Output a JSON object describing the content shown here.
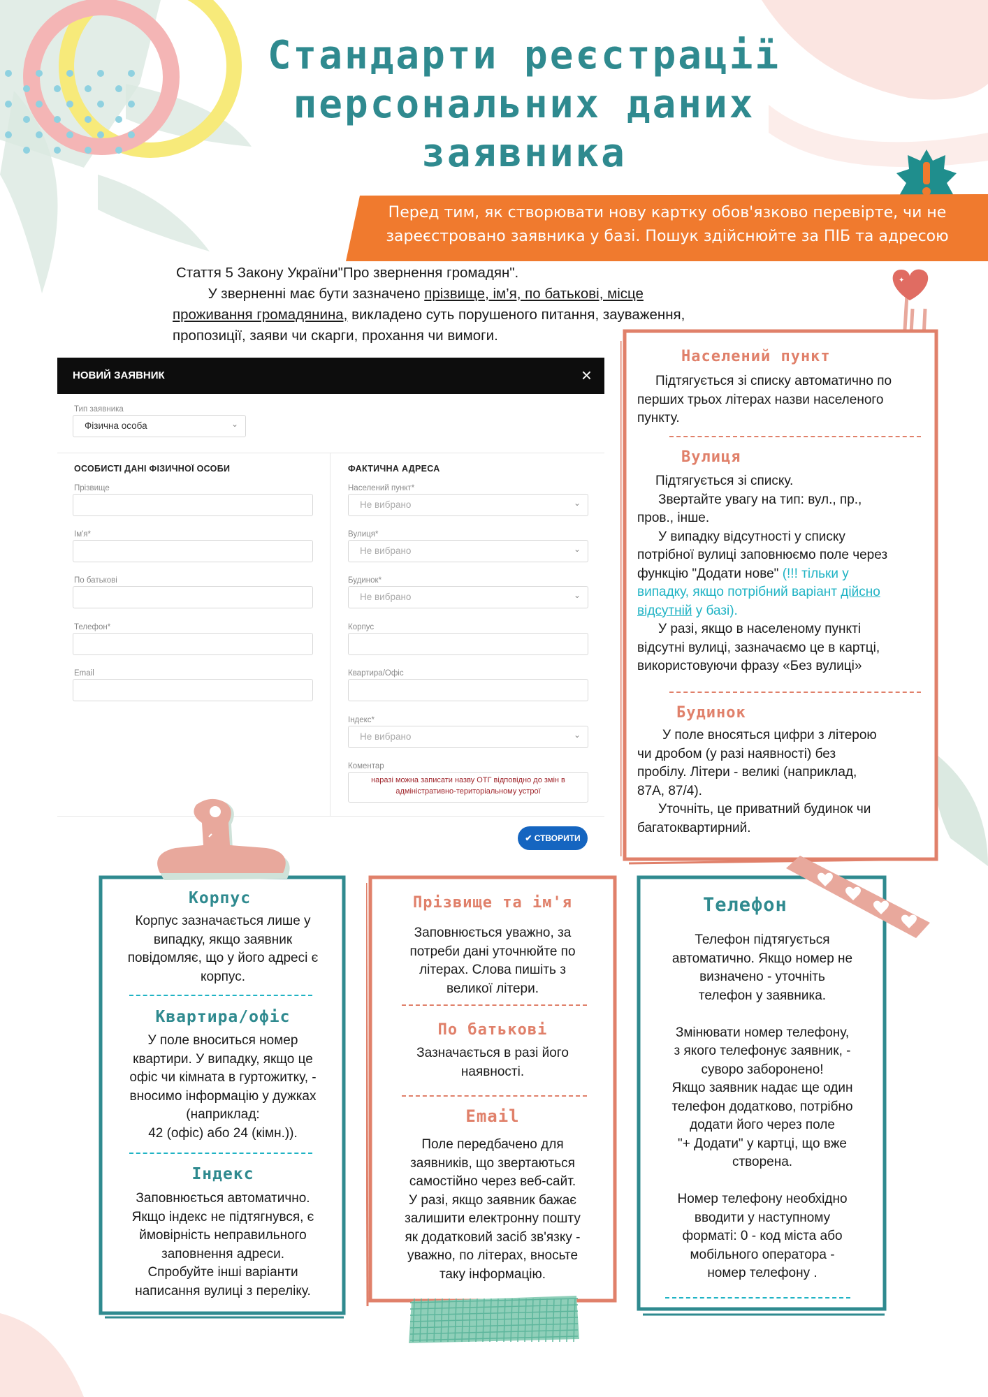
{
  "title": [
    "Стандарти реєстрації",
    "персональних даних",
    "заявника"
  ],
  "banner": {
    "line1": "Перед тим, як створювати нову картку обов'язково перевірте, чи не",
    "line2": "зареєстровано заявника у базі. Пошук здійснюйте за ПІБ та адресою"
  },
  "law": {
    "line1": "Стаття 5 Закону України\"Про звернення громадян\".",
    "line2_pre": "У зверненні має бути зазначено ",
    "line2_u": "прізвище, ім’я, по батькові, місце",
    "line3_u": "проживання громадянина,",
    "line3_post": " викладено суть порушеного питання, зауваження,",
    "line4": "пропозиції, заяви чи скарги, прохання чи вимоги."
  },
  "form": {
    "header": "НОВИЙ ЗАЯВНИК",
    "close": "×",
    "type_label": "Тип заявника",
    "type_value": "Фізична особа",
    "personal_section": "ОСОБИСТІ ДАНІ ФІЗИЧНОЇ ОСОБИ",
    "address_section": "ФАКТИЧНА АДРЕСА",
    "personal_fields": [
      "Прізвище",
      "Ім'я*",
      "По батькові",
      "Телефон*",
      "Email"
    ],
    "address_fields": {
      "settlement": "Населений пункт*",
      "street": "Вулиця*",
      "building": "Будинок*",
      "block": "Корпус",
      "apartment": "Квартира/Офіс",
      "index": "Індекс*",
      "comment": "Коментар"
    },
    "placeholder": "Не вибрано",
    "comment_text": "наразі можна записати назву ОТГ відповідно до змін в адміністративно-територіальному устрої",
    "create_button": "✔ СТВОРИТИ"
  },
  "right_card": {
    "settlement_title": "Населений пункт",
    "settlement_text": [
      "Підтягується зі списку автоматично по",
      "перших трьох літерах назви населеного",
      "пункту."
    ],
    "street_title": "Вулиця",
    "street_text": [
      "Підтягується зі списку.",
      "Звертайте увагу на тип: вул., пр.,",
      "пров., інше.",
      "У випадку відсутності у списку",
      "потрібної вулиці заповнюємо поле через",
      "функцію \"Додати нове\" "
    ],
    "street_note1": "(!!! тільки у",
    "street_note2": "випадку,  якщо потрібний варіант ",
    "street_note2_u": "дійсно",
    "street_note3_u": "відсутній",
    "street_note3": " у базі).",
    "street_text2": [
      "У разі, якщо в населеному пункті",
      "відсутні вулиці, зазначаємо це в картці,",
      "використовуючи фразу «Без вулиці»"
    ],
    "building_title": "Будинок",
    "building_text": [
      "У поле вносяться цифри з літерою",
      "чи дробом (у разі наявності) без",
      "пробілу. Літери - великі (наприклад,",
      "87А, 87/4).",
      "Уточніть, це приватний будинок чи",
      "багатоквартирний."
    ]
  },
  "card_left": {
    "block_title": "Корпус",
    "block_text": [
      "Корпус зазначається лише у",
      "випадку, якщо заявник",
      "повідомляє, що у його адресі є",
      "корпус."
    ],
    "apt_title": "Квартира/офіс",
    "apt_text": [
      "У поле вноситься номер",
      "квартири. У випадку, якщо це",
      "офіс чи кімната в гуртожитку, -",
      "вносимо інформацію у дужках",
      "(наприклад:",
      "42 (офіс) або 24 (кімн.))."
    ],
    "index_title": "Індекс",
    "index_text": [
      "Заповнюється автоматично.",
      "Якщо індекс не підтягнувся, є",
      "ймовірність неправильного",
      "заповнення адреси.",
      "Спробуйте інші варіанти",
      "написання вулиці з переліку."
    ]
  },
  "card_middle": {
    "name_title": "Прізвище та ім'я",
    "name_text": [
      "Заповнюється уважно, за",
      "потреби дані уточнюйте по",
      "літерах. Слова пишіть з",
      "великої літери."
    ],
    "patronymic_title": "По батькові",
    "patronymic_text": [
      "Зазначається в разі його",
      "наявності."
    ],
    "email_title": "Email",
    "email_text": [
      "Поле передбачено для",
      "заявників, що звертаються",
      "самостійно через веб-сайт.",
      "У разі, якщо заявник бажає",
      "залишити електронну пошту",
      "як додатковий засіб зв'язку -",
      "уважно, по літерах, вносьте",
      "таку інформацію."
    ]
  },
  "card_right": {
    "phone_title": "Телефон",
    "phone_text1": [
      "Телефон підтягується",
      "автоматично. Якщо номер не",
      "визначено - уточніть",
      "телефон у заявника."
    ],
    "phone_text2": [
      "Змінювати номер телефону,",
      "з якого телефонує заявник, -",
      "суворо заборонено!",
      "Якщо заявник надає ще один",
      "телефон додатково, потрібно",
      "додати його через поле",
      "\"+ Додати\" у картці, що вже",
      "створена."
    ],
    "phone_text3": [
      "Номер телефону необхідно",
      "вводити у наступному",
      "форматі: 0 - код міста або",
      "мобільного оператора -",
      "номер телефону ."
    ]
  },
  "colors": {
    "teal": "#2f8a8f",
    "orange": "#f07a2e",
    "coral": "#e0806a",
    "cyan": "#1fb3c4",
    "button_blue": "#1565c0"
  },
  "icons": [
    "exclamation-badge-icon",
    "heart-paperclip-icon",
    "clip-icon",
    "heart-tape-icon",
    "chevron-down-icon",
    "close-icon",
    "check-icon"
  ]
}
